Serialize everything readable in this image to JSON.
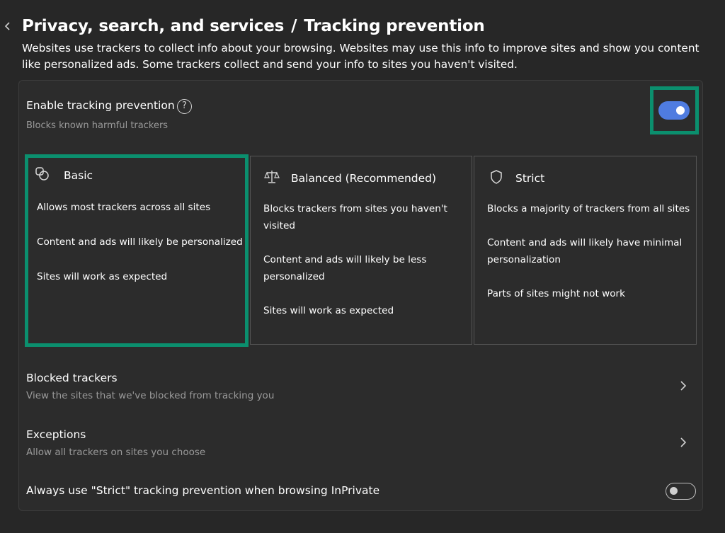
{
  "header": {
    "breadcrumb_parent": "Privacy, search, and services",
    "breadcrumb_separator": "/",
    "title": "Tracking prevention",
    "description": "Websites use trackers to collect info about your browsing. Websites may use this info to improve sites and show you content like personalized ads. Some trackers collect and send your info to sites you haven't visited."
  },
  "enable": {
    "title": "Enable tracking prevention",
    "help_glyph": "?",
    "subtitle": "Blocks known harmful trackers",
    "enabled": true
  },
  "levels": {
    "selected": "basic",
    "basic": {
      "title": "Basic",
      "lines": [
        "Allows most trackers across all sites",
        "Content and ads will likely be personalized",
        "Sites will work as expected"
      ]
    },
    "balanced": {
      "title": "Balanced (Recommended)",
      "lines": [
        "Blocks trackers from sites you haven't",
        "visited",
        "Content and ads will likely be less",
        "personalized",
        "Sites will work as expected"
      ]
    },
    "strict": {
      "title": "Strict",
      "lines": [
        "Blocks a majority of trackers from all sites",
        "Content and ads will likely have minimal",
        "personalization",
        "Parts of sites might not work"
      ]
    }
  },
  "rows": {
    "blocked": {
      "title": "Blocked trackers",
      "subtitle": "View the sites that we've blocked from tracking you"
    },
    "exceptions": {
      "title": "Exceptions",
      "subtitle": "Allow all trackers on sites you choose"
    },
    "inprivate": {
      "title": "Always use \"Strict\" tracking prevention when browsing InPrivate",
      "enabled": false
    }
  },
  "colors": {
    "background": "#272727",
    "panel": "#2c2c2c",
    "toggle_on": "#4f7ce0",
    "highlight": "#0b8f6e",
    "subtext": "#9a9a9a"
  },
  "icons": {
    "back": "chevron-left-icon",
    "help": "question-circle-icon",
    "basic": "overlapping-shapes-icon",
    "balanced": "scales-icon",
    "strict": "shield-icon",
    "row_nav": "chevron-right-icon"
  }
}
